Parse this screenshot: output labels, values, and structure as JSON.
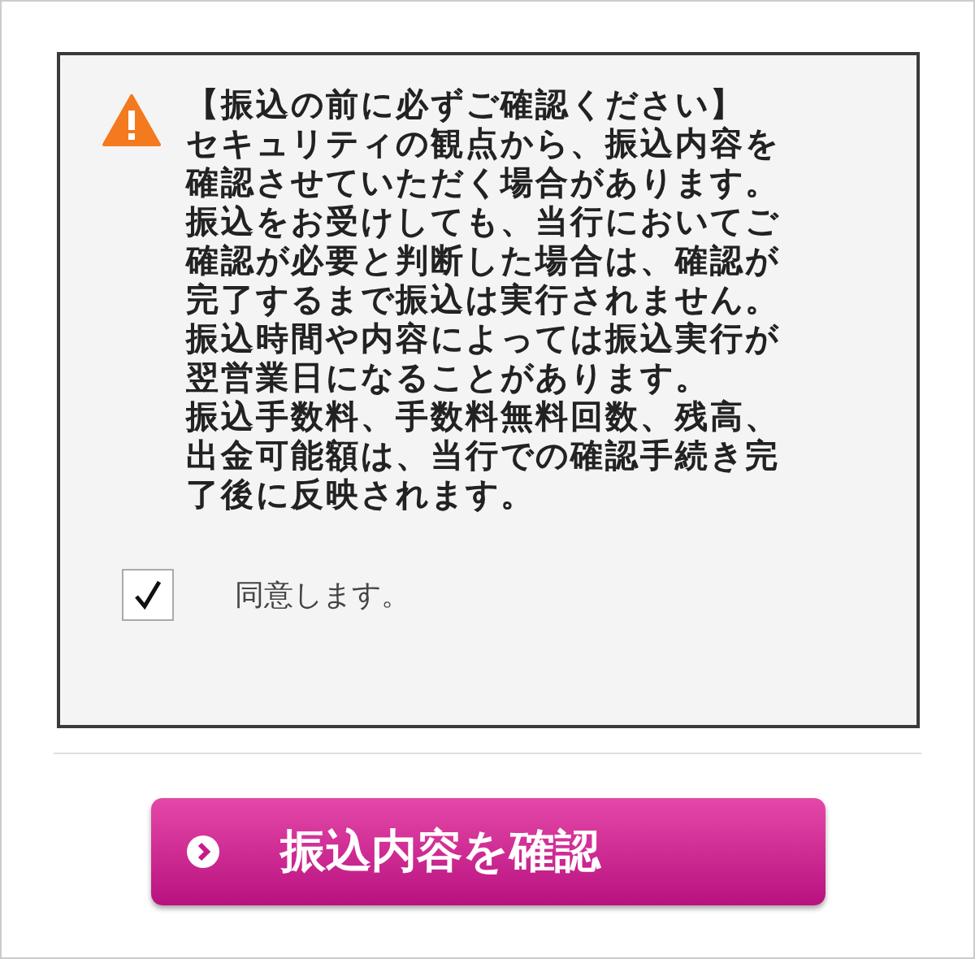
{
  "notice": {
    "title": "【振込の前に必ずご確認ください】",
    "lines": [
      "セキュリティの観点から、振込内容を",
      "確認させていただく場合があります。",
      "振込をお受けしても、当行においてご",
      "確認が必要と判断した場合は、確認が",
      "完了するまで振込は実行されません。",
      "振込時間や内容によっては振込実行が",
      "翌営業日になることがあります。",
      "振込手数料、手数料無料回数、残高、",
      "出金可能額は、当行での確認手続き完",
      "了後に反映されます。"
    ]
  },
  "agree": {
    "label": "同意します。",
    "checked": true
  },
  "confirm_button": {
    "label": "振込内容を確認"
  }
}
